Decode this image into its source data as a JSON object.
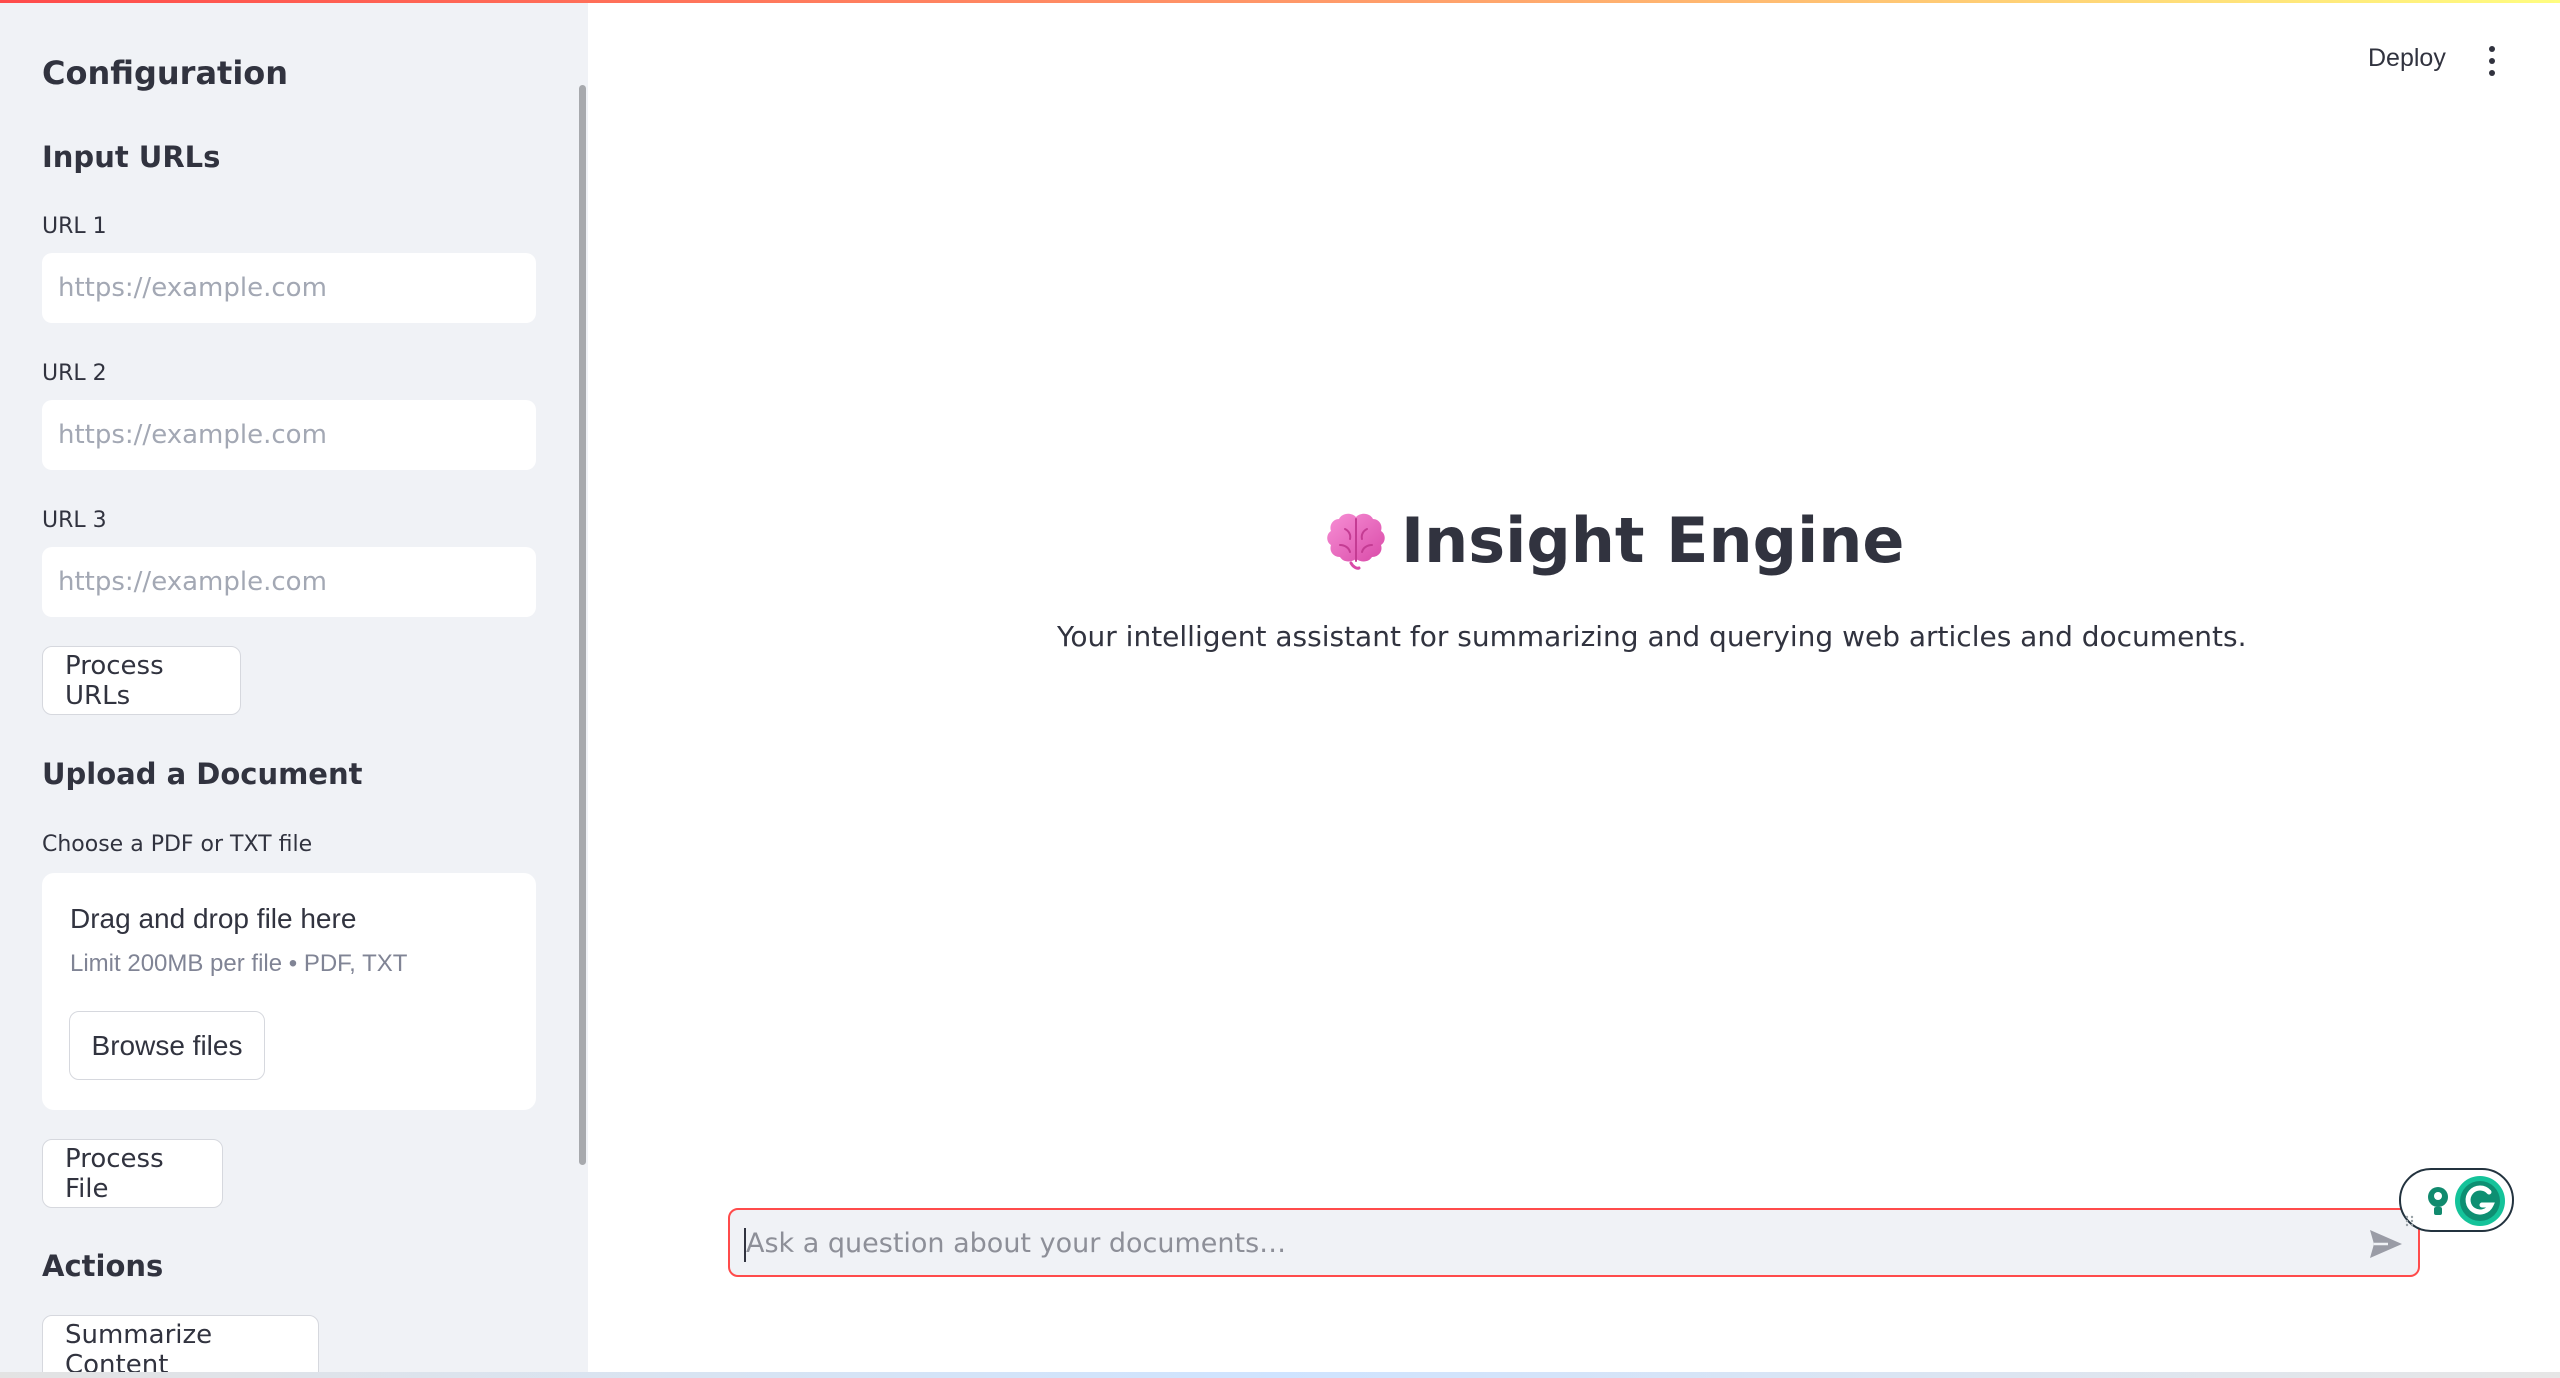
{
  "sidebar": {
    "title": "Configuration",
    "input_urls_heading": "Input URLs",
    "urls": [
      {
        "label": "URL 1",
        "placeholder": "https://example.com"
      },
      {
        "label": "URL 2",
        "placeholder": "https://example.com"
      },
      {
        "label": "URL 3",
        "placeholder": "https://example.com"
      }
    ],
    "process_urls_button": "Process URLs",
    "upload_heading": "Upload a Document",
    "upload_label": "Choose a PDF or TXT file",
    "dropzone": {
      "title": "Drag and drop file here",
      "limit": "Limit 200MB per file • PDF, TXT",
      "browse_button": "Browse files"
    },
    "process_file_button": "Process File",
    "actions_heading": "Actions",
    "summarize_button": "Summarize Content"
  },
  "header": {
    "deploy_label": "Deploy",
    "menu_icon": "kebab-menu-icon"
  },
  "main": {
    "title_icon": "brain-icon",
    "title": "Insight Engine",
    "subtitle": "Your intelligent assistant for summarizing and querying web articles and documents."
  },
  "chat": {
    "placeholder": "Ask a question about your documents…",
    "send_icon": "send-icon"
  },
  "colors": {
    "accent": "#ff4b4b",
    "sidebar_bg": "#f0f2f6",
    "text": "#31333f",
    "brain": "#f06ac0",
    "grammarly": "#15c39a"
  }
}
